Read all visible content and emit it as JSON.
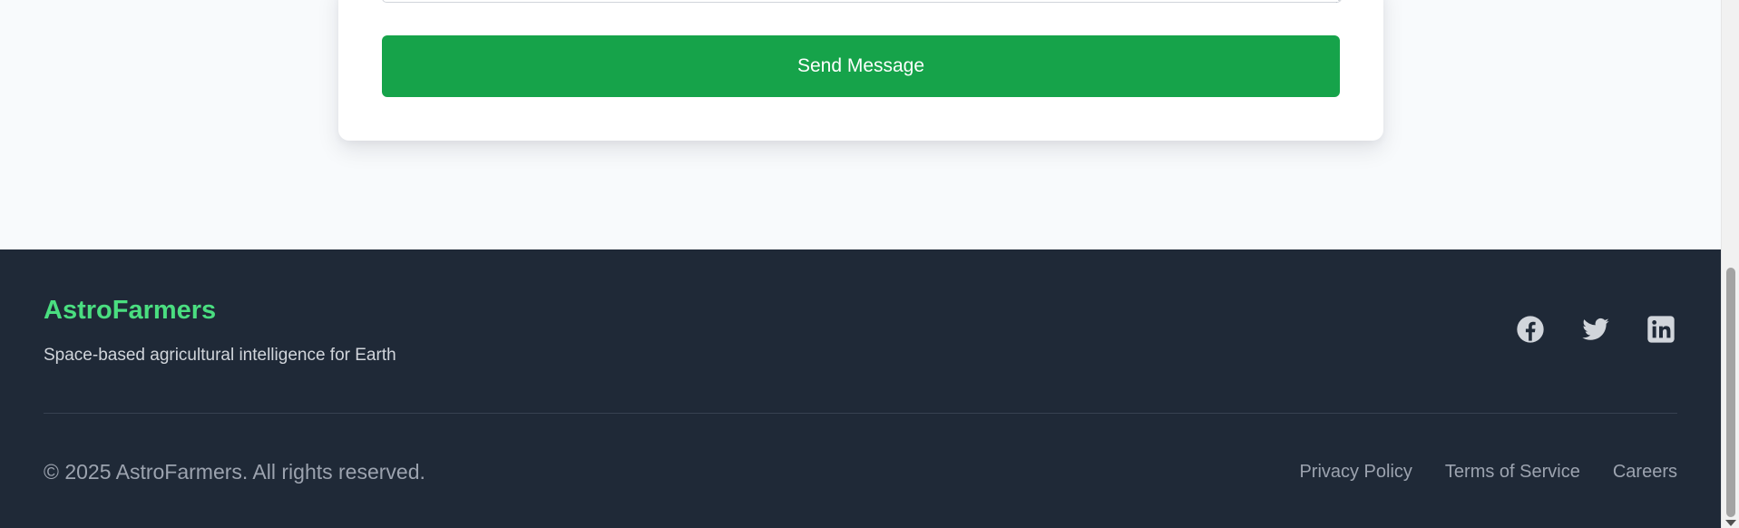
{
  "contact_form": {
    "send_label": "Send Message"
  },
  "footer": {
    "brand": "AstroFarmers",
    "tagline": "Space-based agricultural intelligence for Earth",
    "socials": [
      {
        "name": "facebook-icon"
      },
      {
        "name": "twitter-icon"
      },
      {
        "name": "linkedin-icon"
      }
    ],
    "copyright": "© 2025 AstroFarmers. All rights reserved.",
    "links": [
      "Privacy Policy",
      "Terms of Service",
      "Careers"
    ]
  },
  "colors": {
    "accent": "#16a34a",
    "brand": "#4ade80",
    "footer_bg": "#1f2937",
    "page_bg": "#f8fafc"
  }
}
